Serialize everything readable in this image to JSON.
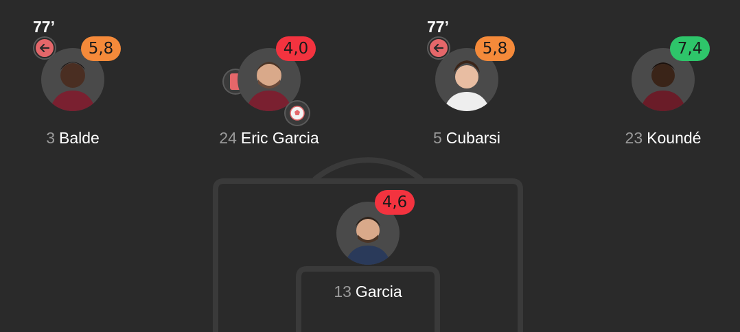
{
  "colors": {
    "rating_orange": "#f58a3a",
    "rating_red": "#f3333f",
    "rating_green": "#2ec56a",
    "background": "#2a2a2a"
  },
  "players": [
    {
      "number": "3",
      "name": "Balde",
      "rating": "5,8",
      "rating_color": "#f58a3a",
      "sub_time": "77’",
      "icons": [
        "sub-off-icon"
      ]
    },
    {
      "number": "24",
      "name": "Eric Garcia",
      "rating": "4,0",
      "rating_color": "#f3333f",
      "icons": [
        "red-card-icon",
        "own-goal-icon"
      ]
    },
    {
      "number": "5",
      "name": "Cubarsi",
      "rating": "5,8",
      "rating_color": "#f58a3a",
      "sub_time": "77’",
      "icons": [
        "sub-off-icon"
      ]
    },
    {
      "number": "23",
      "name": "Koundé",
      "rating": "7,4",
      "rating_color": "#2ec56a",
      "icons": []
    },
    {
      "number": "13",
      "name": "Garcia",
      "rating": "4,6",
      "rating_color": "#f3333f",
      "icons": []
    }
  ]
}
